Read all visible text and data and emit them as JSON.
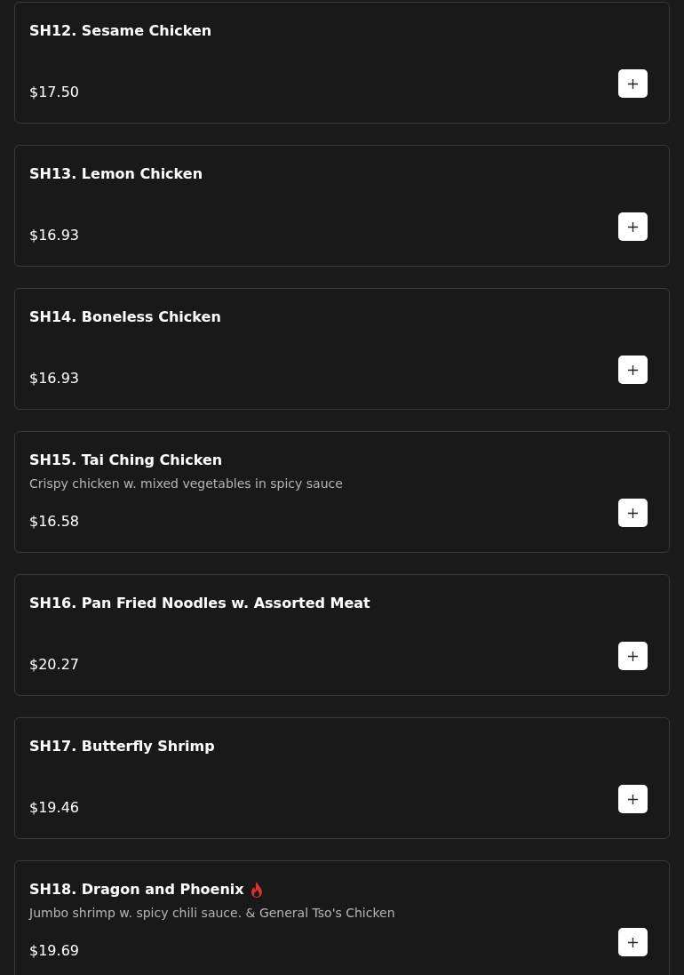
{
  "items": [
    {
      "name": "SH12. Sesame Chicken",
      "price": "$17.50",
      "spicy": false
    },
    {
      "name": "SH13. Lemon Chicken",
      "price": "$16.93",
      "spicy": false
    },
    {
      "name": "SH14. Boneless Chicken",
      "price": "$16.93",
      "spicy": false
    },
    {
      "name": "SH15. Tai Ching Chicken",
      "description": "Crispy chicken w. mixed vegetables in spicy sauce",
      "price": "$16.58",
      "spicy": false
    },
    {
      "name": "SH16. Pan Fried Noodles w. Assorted Meat",
      "price": "$20.27",
      "spicy": false
    },
    {
      "name": "SH17. Butterfly Shrimp",
      "price": "$19.46",
      "spicy": false
    },
    {
      "name": "SH18. Dragon and Phoenix",
      "description": "Jumbo shrimp w. spicy chili sauce. & General Tso's Chicken",
      "price": "$19.69",
      "spicy": true
    }
  ]
}
